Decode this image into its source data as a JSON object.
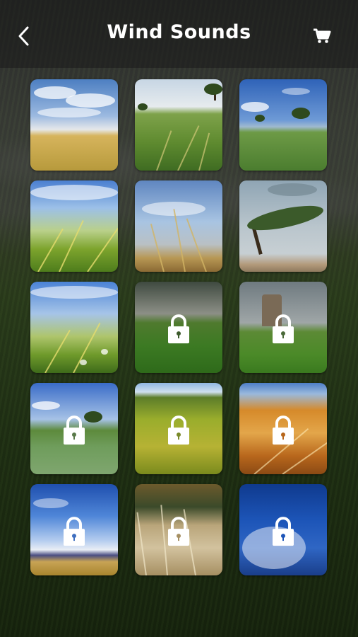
{
  "header": {
    "title": "Wind Sounds",
    "back_icon": "chevron-left-icon",
    "cart_icon": "shopping-cart-icon"
  },
  "tiles": [
    {
      "name": "sky-field",
      "locked": false
    },
    {
      "name": "green-field-tree",
      "locked": false
    },
    {
      "name": "blue-sky-field",
      "locked": false
    },
    {
      "name": "wheat-grass-sky",
      "locked": false
    },
    {
      "name": "grass-stalks-clouds",
      "locked": false
    },
    {
      "name": "windy-tree",
      "locked": false
    },
    {
      "name": "grass-daisies",
      "locked": false
    },
    {
      "name": "storm-field",
      "locked": true
    },
    {
      "name": "tower-field",
      "locked": true
    },
    {
      "name": "blue-meadow-tree",
      "locked": true
    },
    {
      "name": "yellow-grass-hills",
      "locked": true
    },
    {
      "name": "golden-grass",
      "locked": true
    },
    {
      "name": "mountain-field",
      "locked": true
    },
    {
      "name": "reeds",
      "locked": true
    },
    {
      "name": "dandelion",
      "locked": true
    }
  ],
  "colors": {
    "title": "#ffffff",
    "lock": "#ffffff"
  }
}
